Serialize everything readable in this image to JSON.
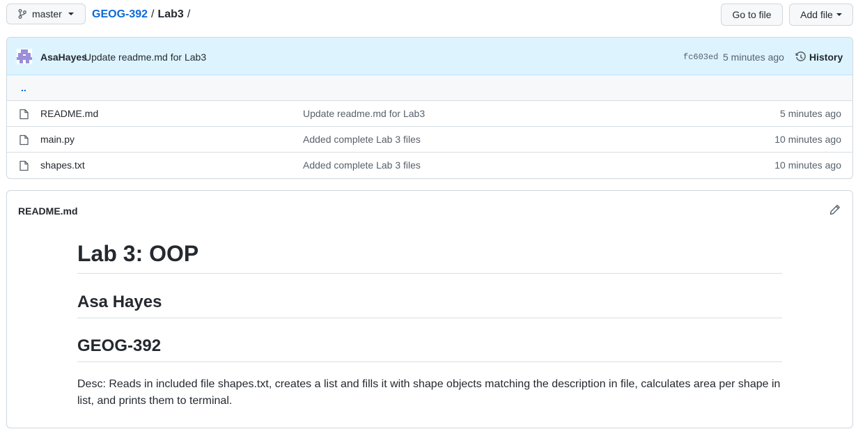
{
  "topbar": {
    "branch": "master",
    "breadcrumb": {
      "repo": "GEOG-392",
      "sep1": "/",
      "folder": "Lab3",
      "sep2": "/"
    },
    "go_to_file": "Go to file",
    "add_file": "Add file"
  },
  "commit": {
    "author": "AsaHayes",
    "message": "Update readme.md for Lab3",
    "sha": "fc603ed",
    "age": "5 minutes ago",
    "history": "History"
  },
  "parent_dir": "..",
  "files": [
    {
      "name": "README.md",
      "message": "Update readme.md for Lab3",
      "age": "5 minutes ago",
      "icon": "file-icon"
    },
    {
      "name": "main.py",
      "message": "Added complete Lab 3 files",
      "age": "10 minutes ago",
      "icon": "file-icon"
    },
    {
      "name": "shapes.txt",
      "message": "Added complete Lab 3 files",
      "age": "10 minutes ago",
      "icon": "file-icon"
    }
  ],
  "readme": {
    "filename": "README.md",
    "h1": "Lab 3: OOP",
    "h2_author": "Asa Hayes",
    "h2_course": "GEOG-392",
    "desc": "Desc: Reads in included file shapes.txt, creates a list and fills it with shape objects matching the description in file, calculates area per shape in list, and prints them to terminal."
  },
  "colors": {
    "accent": "#0969da",
    "commit_bar": "#ddf4ff",
    "border": "#d0d7de",
    "avatar": "#9a8fd8"
  }
}
